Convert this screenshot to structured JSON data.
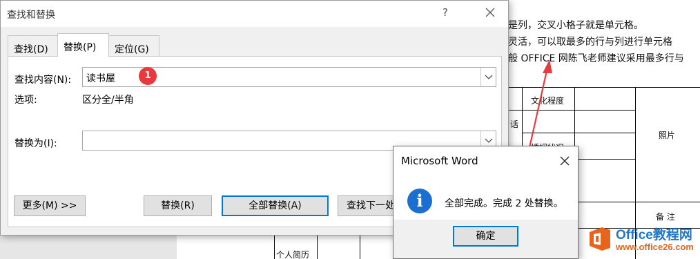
{
  "document": {
    "line_1": "是列，交叉小格子就是单元格。",
    "line_2": "灵活，可以取最多的行与列进行单元格",
    "line_3": "般 OFFICE 网陈飞老师建议采用最多行与",
    "cells": {
      "education": "文化程度",
      "phone_fragment": "话",
      "marital": "婚姻状况",
      "photo": "照片",
      "remarks": "备  注",
      "resume": "个人简历"
    }
  },
  "find_dialog": {
    "title": "查找和替换",
    "help": "?",
    "tabs": [
      "查找(D)",
      "替换(P)",
      "定位(G)"
    ],
    "find_label": "查找内容(N):",
    "find_value": "读书屋",
    "options_label": "选项:",
    "options_value": "区分全/半角",
    "replace_label": "替换为(I):",
    "replace_value": "",
    "buttons": {
      "more": "更多(M) >>",
      "replace": "替换(R)",
      "replace_all": "全部替换(A)",
      "find_next": "查找下一处"
    },
    "callout": "1"
  },
  "message_box": {
    "title": "Microsoft Word",
    "text": "全部完成。完成 2 处替换。",
    "ok": "确定"
  },
  "watermark": {
    "brand": "Office教程网",
    "url": "www.office26.com"
  },
  "colors": {
    "accent": "#0078d7",
    "callout": "#e8393f",
    "arrow": "#e8393f",
    "info_icon": "#1a6fd0"
  }
}
